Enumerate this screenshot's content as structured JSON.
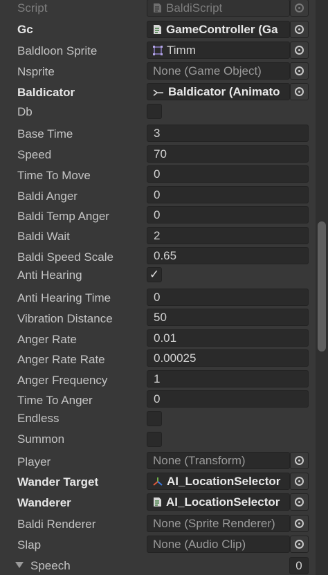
{
  "rows": {
    "script": {
      "label": "Script",
      "value": "BaldiScript"
    },
    "gc": {
      "label": "Gc",
      "value": "GameController (Ga"
    },
    "baldloon_sprite": {
      "label": "Baldloon Sprite",
      "value": "Timm"
    },
    "nsprite": {
      "label": "Nsprite",
      "value": "None (Game Object)"
    },
    "baldicator": {
      "label": "Baldicator",
      "value": "Baldicator (Animato"
    },
    "db": {
      "label": "Db"
    },
    "base_time": {
      "label": "Base Time",
      "value": "3"
    },
    "speed": {
      "label": "Speed",
      "value": "70"
    },
    "time_to_move": {
      "label": "Time To Move",
      "value": "0"
    },
    "baldi_anger": {
      "label": "Baldi Anger",
      "value": "0"
    },
    "baldi_temp_anger": {
      "label": "Baldi Temp Anger",
      "value": "0"
    },
    "baldi_wait": {
      "label": "Baldi Wait",
      "value": "2"
    },
    "baldi_speed_scale": {
      "label": "Baldi Speed Scale",
      "value": "0.65"
    },
    "anti_hearing": {
      "label": "Anti Hearing",
      "check": "✓"
    },
    "anti_hearing_time": {
      "label": "Anti Hearing Time",
      "value": "0"
    },
    "vibration_distance": {
      "label": "Vibration Distance",
      "value": "50"
    },
    "anger_rate": {
      "label": "Anger Rate",
      "value": "0.01"
    },
    "anger_rate_rate": {
      "label": "Anger Rate Rate",
      "value": "0.00025"
    },
    "anger_frequency": {
      "label": "Anger Frequency",
      "value": "1"
    },
    "time_to_anger": {
      "label": "Time To Anger",
      "value": "0"
    },
    "endless": {
      "label": "Endless"
    },
    "summon": {
      "label": "Summon"
    },
    "player": {
      "label": "Player",
      "value": "None (Transform)"
    },
    "wander_target": {
      "label": "Wander Target",
      "value": "AI_LocationSelector"
    },
    "wanderer": {
      "label": "Wanderer",
      "value": "AI_LocationSelector"
    },
    "baldi_renderer": {
      "label": "Baldi Renderer",
      "value": "None (Sprite Renderer)"
    },
    "slap": {
      "label": "Slap",
      "value": "None (Audio Clip)"
    },
    "speech": {
      "label": "Speech",
      "value": "0"
    }
  },
  "colors": {
    "background": "#383838",
    "field": "#2a2a2a",
    "scroll_thumb": "#5f5f5f"
  }
}
